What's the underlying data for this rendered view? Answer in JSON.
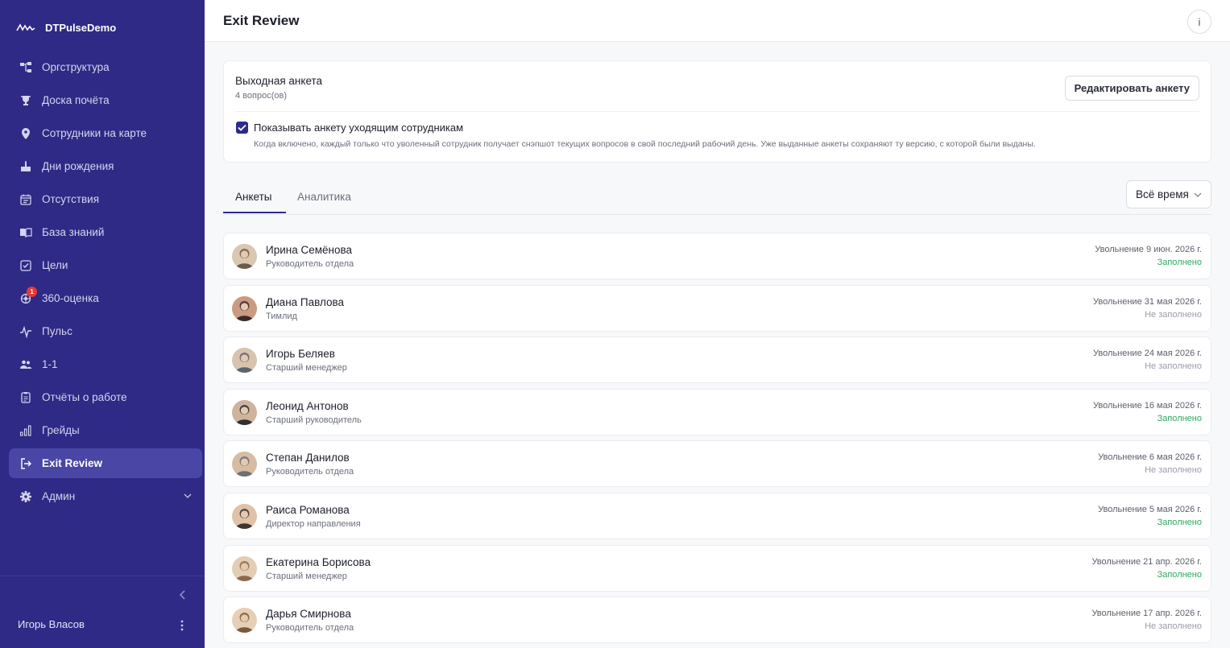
{
  "brand": {
    "name": "DTPulseDemo"
  },
  "sidebar": {
    "items": [
      {
        "label": "Оргструктура",
        "icon": "org-structure-icon"
      },
      {
        "label": "Доска почёта",
        "icon": "trophy-icon"
      },
      {
        "label": "Сотрудники на карте",
        "icon": "map-pin-icon"
      },
      {
        "label": "Дни рождения",
        "icon": "cake-icon"
      },
      {
        "label": "Отсутствия",
        "icon": "calendar-icon"
      },
      {
        "label": "База знаний",
        "icon": "book-icon"
      },
      {
        "label": "Цели",
        "icon": "checkbox-icon"
      },
      {
        "label": "360-оценка",
        "icon": "network-icon",
        "badge": "1"
      },
      {
        "label": "Пульс",
        "icon": "pulse-icon"
      },
      {
        "label": "1-1",
        "icon": "people-icon"
      },
      {
        "label": "Отчёты о работе",
        "icon": "report-icon"
      },
      {
        "label": "Грейды",
        "icon": "bar-chart-icon"
      },
      {
        "label": "Exit Review",
        "icon": "exit-icon",
        "active": true
      },
      {
        "label": "Админ",
        "icon": "gear-icon",
        "expandable": true
      }
    ],
    "user_name": "Игорь Власов"
  },
  "header": {
    "title": "Exit Review",
    "info_label": "i"
  },
  "survey": {
    "title": "Выходная анкета",
    "subtitle": "4 вопрос(ов)",
    "edit_label": "Редактировать анкету",
    "show_label": "Показывать анкету уходящим сотрудникам",
    "show_checked": true,
    "hint": "Когда включено, каждый только что уволенный сотрудник получает снэпшот текущих вопросов в свой последний рабочий день. Уже выданные анкеты сохраняют ту версию, с которой были выданы."
  },
  "tabs": [
    {
      "label": "Анкеты",
      "active": true
    },
    {
      "label": "Аналитика",
      "active": false
    }
  ],
  "period": {
    "selected": "Всё время"
  },
  "rows": [
    {
      "name": "Ирина Семёнова",
      "role": "Руководитель отдела",
      "date": "Увольнение 9 июн. 2026 г.",
      "status": "Заполнено",
      "done": true
    },
    {
      "name": "Диана Павлова",
      "role": "Тимлид",
      "date": "Увольнение 31 мая 2026 г.",
      "status": "Не заполнено",
      "done": false
    },
    {
      "name": "Игорь Беляев",
      "role": "Старший менеджер",
      "date": "Увольнение 24 мая 2026 г.",
      "status": "Не заполнено",
      "done": false
    },
    {
      "name": "Леонид Антонов",
      "role": "Старший руководитель",
      "date": "Увольнение 16 мая 2026 г.",
      "status": "Заполнено",
      "done": true
    },
    {
      "name": "Степан Данилов",
      "role": "Руководитель отдела",
      "date": "Увольнение 6 мая 2026 г.",
      "status": "Не заполнено",
      "done": false
    },
    {
      "name": "Раиса Романова",
      "role": "Директор направления",
      "date": "Увольнение 5 мая 2026 г.",
      "status": "Заполнено",
      "done": true
    },
    {
      "name": "Екатерина Борисова",
      "role": "Старший менеджер",
      "date": "Увольнение 21 апр. 2026 г.",
      "status": "Заполнено",
      "done": true
    },
    {
      "name": "Дарья Смирнова",
      "role": "Руководитель отдела",
      "date": "Увольнение 17 апр. 2026 г.",
      "status": "Не заполнено",
      "done": false
    }
  ],
  "colors": {
    "sidebar": "#2e2a85",
    "accent": "#2f2b8a",
    "done": "#2ea862",
    "pending": "#9a9dab"
  }
}
